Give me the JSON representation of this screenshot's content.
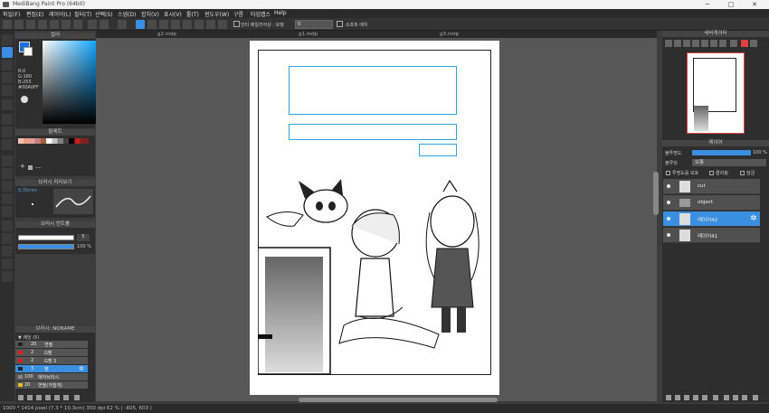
{
  "titlebar": {
    "title": "MediBang Paint Pro (64bit)",
    "minimize": "─",
    "maximize": "□",
    "close": "✕"
  },
  "menu": [
    "파일(F)",
    "편집(E)",
    "레이어(L)",
    "필터(T)",
    "선택(S)",
    "스냅(D)",
    "합치(V)",
    "표시(V)",
    "툴(T)",
    "윈도우(W)",
    "구름",
    "타임랩스",
    "Help"
  ],
  "toolbar": {
    "brush_label": "안티 에일리어싱 : 보정",
    "correction_value": "0",
    "softedge_label": "소프트 에지"
  },
  "tabs": [
    "g2.mdp",
    "g1.mdp",
    "g3.mdp"
  ],
  "color_panel": {
    "title": "컬러",
    "readout": [
      "R:0",
      "G:160",
      "B:255",
      "#00A0FF"
    ],
    "primary": "#1a6fdc",
    "secondary": "#ffffff"
  },
  "palette_panel": {
    "title": "팔레트",
    "add": "+",
    "label": "----"
  },
  "brush_preview": {
    "title": "브러시 미리보기",
    "size": "0.35mm"
  },
  "brush_control": {
    "title": "브러시 컨트롤",
    "size_value": "5",
    "opacity_value": "100 %"
  },
  "brush_set": {
    "title": "브러시: NONAME",
    "group": "에딩 (5)",
    "rows": [
      {
        "num": "20",
        "name": "연필",
        "color": "#222222"
      },
      {
        "num": "2",
        "name": "G펜",
        "color": "#e02020"
      },
      {
        "num": "2",
        "name": "G펜 S",
        "color": "#e02020"
      },
      {
        "num": "3",
        "name": "펜",
        "color": "#3b8fe0"
      },
      {
        "num": "100",
        "name": "에어브러시",
        "color": "#888888"
      },
      {
        "num": "20",
        "name": "연필(거칠게)",
        "color": "#e0c020"
      }
    ]
  },
  "navigator": {
    "title": "네비게이터"
  },
  "layer_panel": {
    "title": "레이어",
    "blend_label": "블루딩",
    "blend_mode": "보통",
    "opacity_label": "불투명도",
    "opacity_value": "100 %",
    "options": [
      "투명도를 보호",
      "클리핑",
      "잠금"
    ],
    "layers": [
      "cut",
      "object",
      "레이어42",
      "레이어41"
    ]
  },
  "status": {
    "text": "1000 * 1414 pixel  (7.3 * 10.3cm)  350 dpi  62 %  ( -605, 603 )"
  }
}
